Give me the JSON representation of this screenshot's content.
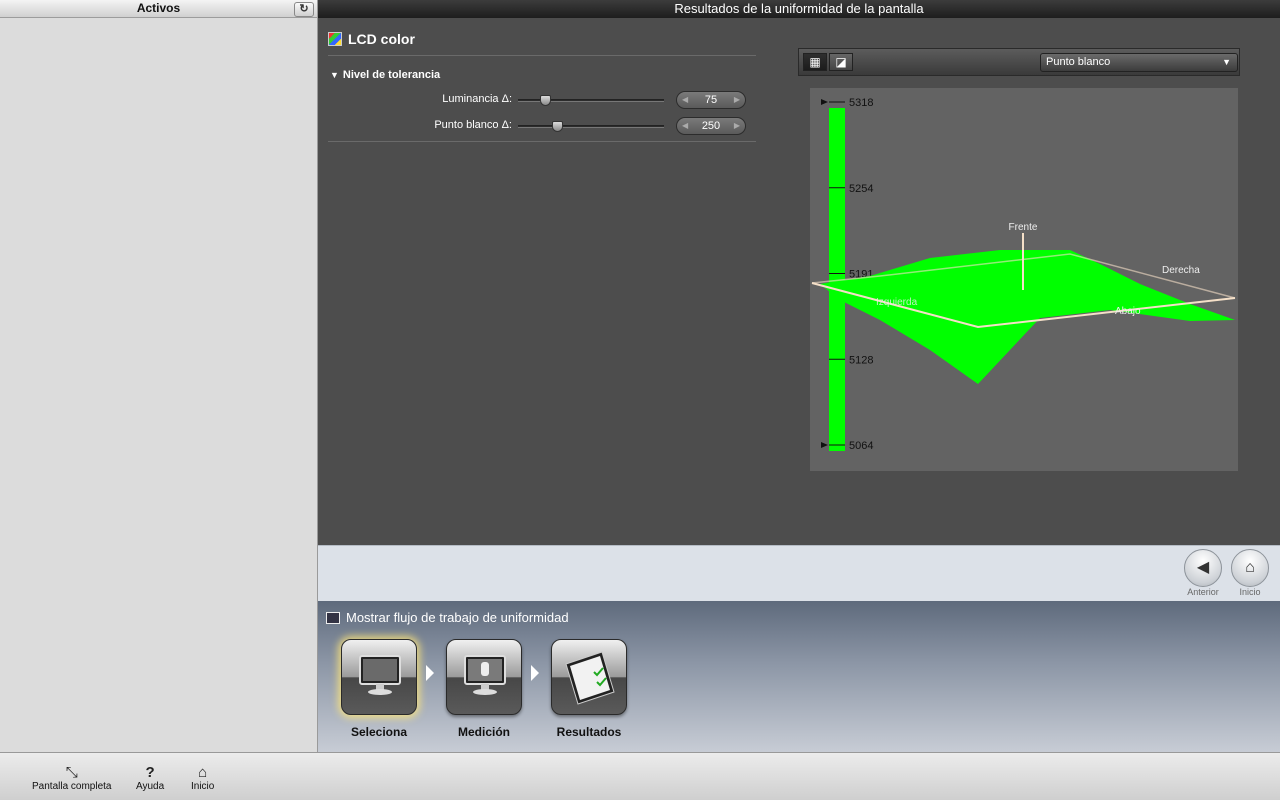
{
  "sidebar": {
    "title": "Activos",
    "refresh_icon": "refresh-icon"
  },
  "titlebar": {
    "title": "Resultados de la uniformidad de la pantalla"
  },
  "device": {
    "name": "LCD color"
  },
  "tolerance": {
    "header": "Nivel de tolerancia",
    "luminance": {
      "label": "Luminancia  Δ:",
      "value": "75",
      "slider_fraction": 0.19
    },
    "whitepoint": {
      "label": "Punto blanco  Δ:",
      "value": "250",
      "slider_fraction": 0.27
    }
  },
  "chart_toolbar": {
    "dropdown_value": "Punto blanco",
    "view_buttons": [
      "grid-view-icon",
      "surface-view-icon"
    ]
  },
  "chart_data": {
    "type": "surface-3d",
    "scale_labels": [
      "5318",
      "5254",
      "5191",
      "5128",
      "5064"
    ],
    "ylim": [
      5064,
      5318
    ],
    "axis_labels": {
      "front": "Frente",
      "right": "Derecha",
      "left": "Izquierda",
      "bottom": "Abajo"
    },
    "colors": {
      "surface": "#00ff00",
      "plane": "#f5e0c8"
    }
  },
  "nav": {
    "back_label": "Anterior",
    "home_label": "Inicio"
  },
  "workflow": {
    "title": "Mostrar flujo de trabajo de uniformidad",
    "steps": [
      {
        "label": "Seleciona",
        "icon": "monitor-select-icon",
        "active": true
      },
      {
        "label": "Medición",
        "icon": "monitor-measure-icon",
        "active": false
      },
      {
        "label": "Resultados",
        "icon": "clipboard-results-icon",
        "active": false
      }
    ]
  },
  "bottombar": {
    "fullscreen_label": "Pantalla completa",
    "help_label": "Ayuda",
    "home_label": "Inicio"
  }
}
